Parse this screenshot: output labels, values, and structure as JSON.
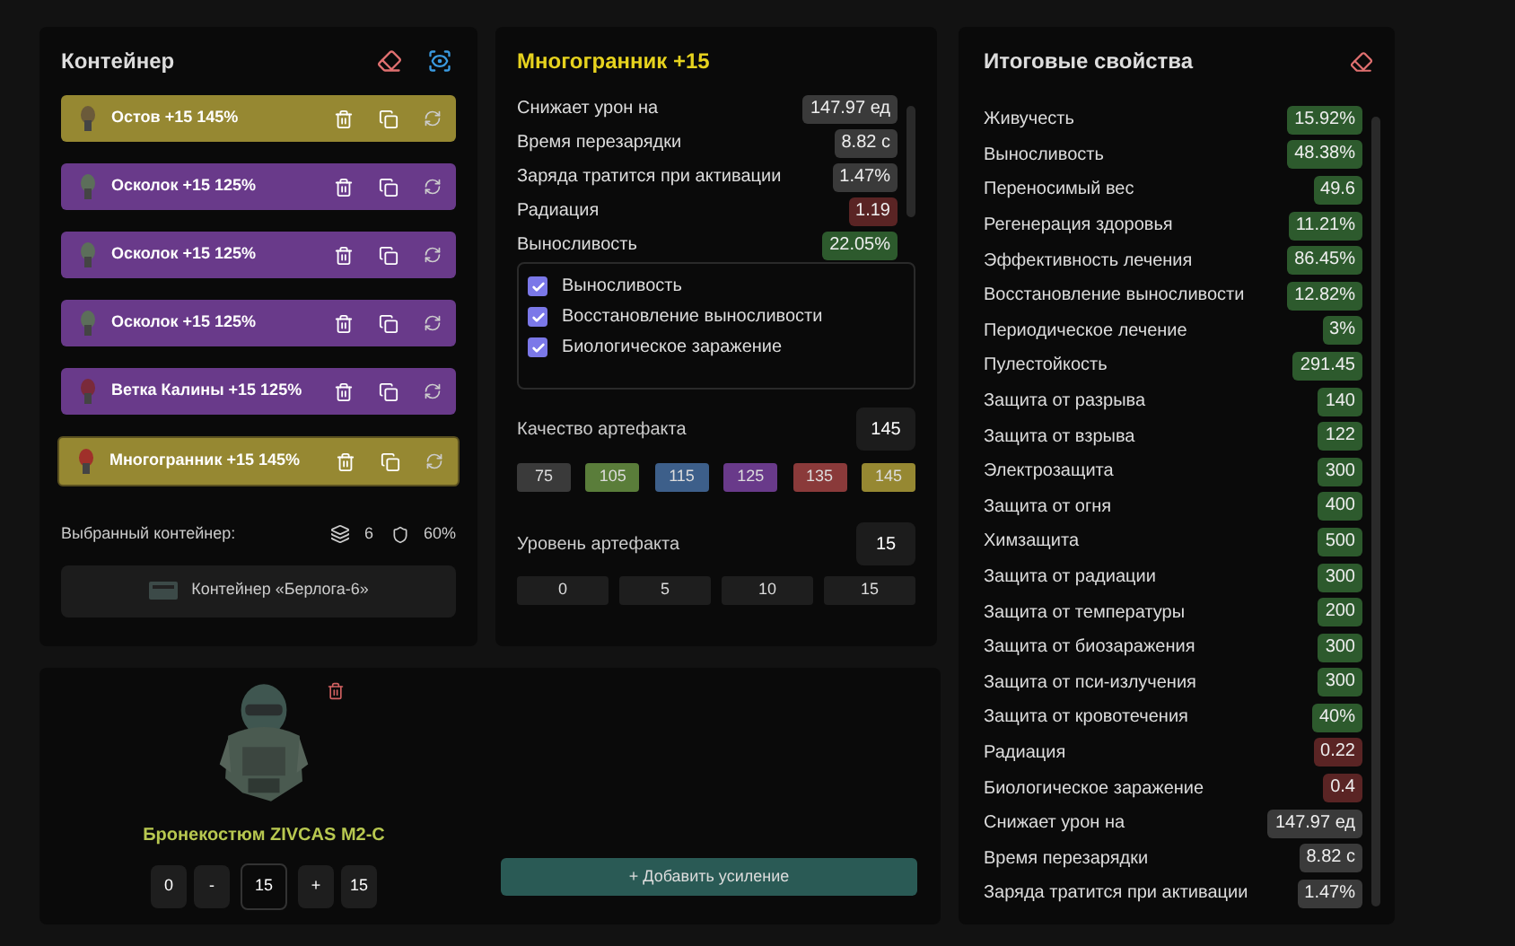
{
  "container": {
    "title": "Контейнер",
    "items": [
      {
        "name": "Остов +15 145%",
        "color": "#968832",
        "selected": false
      },
      {
        "name": "Осколок +15 125%",
        "color": "#693a8a",
        "selected": false
      },
      {
        "name": "Осколок +15 125%",
        "color": "#693a8a",
        "selected": false
      },
      {
        "name": "Осколок +15 125%",
        "color": "#693a8a",
        "selected": false
      },
      {
        "name": "Ветка Калины +15 125%",
        "color": "#693a8a",
        "selected": false
      },
      {
        "name": "Многогранник +15 145%",
        "color": "#968832",
        "selected": true
      }
    ],
    "selected_label": "Выбранный контейнер:",
    "slots": "6",
    "protection": "60%",
    "container_name": "Контейнер «Берлога-6»"
  },
  "artifact": {
    "title": "Многогранник +15",
    "stats": [
      {
        "label": "Снижает урон на",
        "value": "147.97 ед",
        "kind": "neutral"
      },
      {
        "label": "Время перезарядки",
        "value": "8.82 с",
        "kind": "neutral"
      },
      {
        "label": "Заряда тратится при активации",
        "value": "1.47%",
        "kind": "neutral"
      },
      {
        "label": "Радиация",
        "value": "1.19",
        "kind": "bad"
      },
      {
        "label": "Выносливость",
        "value": "22.05%",
        "kind": "good"
      }
    ],
    "options": [
      {
        "label": "Выносливость",
        "checked": true
      },
      {
        "label": "Восстановление выносливости",
        "checked": true
      },
      {
        "label": "Биологическое заражение",
        "checked": true
      }
    ],
    "quality_label": "Качество артефакта",
    "quality_value": "145",
    "quality_options": [
      {
        "label": "75",
        "color": "#3a3a3a"
      },
      {
        "label": "105",
        "color": "#5a7d3a"
      },
      {
        "label": "115",
        "color": "#3d5f8a"
      },
      {
        "label": "125",
        "color": "#693a8a"
      },
      {
        "label": "135",
        "color": "#8a3a3a"
      },
      {
        "label": "145",
        "color": "#968832"
      }
    ],
    "level_label": "Уровень артефакта",
    "level_value": "15",
    "level_options": [
      "0",
      "5",
      "10",
      "15"
    ]
  },
  "totals": {
    "title": "Итоговые свойства",
    "stats": [
      {
        "label": "Живучесть",
        "value": "15.92%",
        "kind": "good"
      },
      {
        "label": "Выносливость",
        "value": "48.38%",
        "kind": "good"
      },
      {
        "label": "Переносимый вес",
        "value": "49.6",
        "kind": "good"
      },
      {
        "label": "Регенерация здоровья",
        "value": "11.21%",
        "kind": "good"
      },
      {
        "label": "Эффективность лечения",
        "value": "86.45%",
        "kind": "good"
      },
      {
        "label": "Восстановление выносливости",
        "value": "12.82%",
        "kind": "good"
      },
      {
        "label": "Периодическое лечение",
        "value": "3%",
        "kind": "good"
      },
      {
        "label": "Пулестойкость",
        "value": "291.45",
        "kind": "good"
      },
      {
        "label": "Защита от разрыва",
        "value": "140",
        "kind": "good"
      },
      {
        "label": "Защита от взрыва",
        "value": "122",
        "kind": "good"
      },
      {
        "label": "Электрозащита",
        "value": "300",
        "kind": "good"
      },
      {
        "label": "Защита от огня",
        "value": "400",
        "kind": "good"
      },
      {
        "label": "Химзащита",
        "value": "500",
        "kind": "good"
      },
      {
        "label": "Защита от радиации",
        "value": "300",
        "kind": "good"
      },
      {
        "label": "Защита от температуры",
        "value": "200",
        "kind": "good"
      },
      {
        "label": "Защита от биозаражения",
        "value": "300",
        "kind": "good"
      },
      {
        "label": "Защита от пси-излучения",
        "value": "300",
        "kind": "good"
      },
      {
        "label": "Защита от кровотечения",
        "value": "40%",
        "kind": "good"
      },
      {
        "label": "Радиация",
        "value": "0.22",
        "kind": "bad"
      },
      {
        "label": "Биологическое заражение",
        "value": "0.4",
        "kind": "bad"
      },
      {
        "label": "Снижает урон на",
        "value": "147.97 ед",
        "kind": "neutral"
      },
      {
        "label": "Время перезарядки",
        "value": "8.82 с",
        "kind": "neutral"
      },
      {
        "label": "Заряда тратится при активации",
        "value": "1.47%",
        "kind": "neutral"
      }
    ]
  },
  "armor": {
    "name": "Бронекостюм ZIVCAS M2-C",
    "min": "0",
    "minus": "-",
    "level": "15",
    "plus": "+",
    "max": "15",
    "add_button": "+ Добавить усиление"
  }
}
